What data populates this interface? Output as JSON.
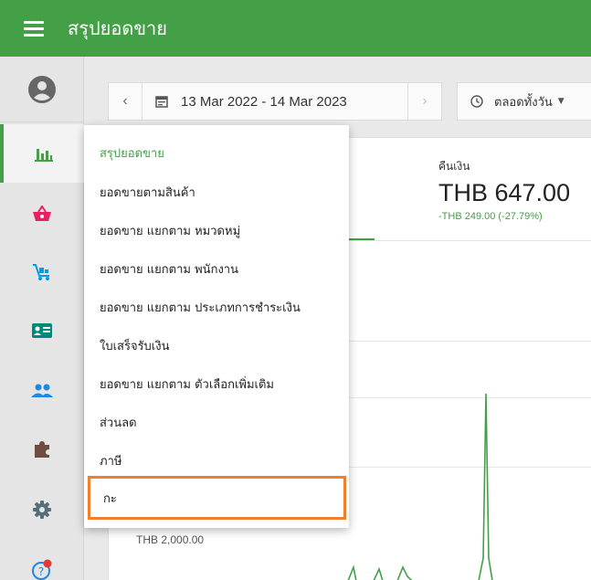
{
  "app": {
    "title": "สรุปยอดขาย"
  },
  "colors": {
    "primary": "#43a047",
    "highlight": "#f08030",
    "badge": "#e53935"
  },
  "sidebar": {
    "items": [
      {
        "name": "profile-icon",
        "active": false
      },
      {
        "name": "bar-chart-icon",
        "active": true
      },
      {
        "name": "basket-icon",
        "active": false
      },
      {
        "name": "cart-icon",
        "active": false
      },
      {
        "name": "id-card-icon",
        "active": false
      },
      {
        "name": "people-icon",
        "active": false
      },
      {
        "name": "puzzle-icon",
        "active": false
      },
      {
        "name": "gear-icon",
        "active": false
      },
      {
        "name": "help-icon",
        "active": false
      }
    ]
  },
  "toolbar": {
    "date_range": "13 Mar 2022 - 14 Mar 2023",
    "time_filter": "ตลอดทั้งวัน"
  },
  "metric": {
    "label": "คืนเงิน",
    "value": "THB 647.00",
    "delta": "-THB 249.00 (-27.79%)"
  },
  "chart": {
    "y_label": "THB 2,000.00"
  },
  "menu": {
    "items": [
      "สรุปยอดขาย",
      "ยอดขายตามสินค้า",
      "ยอดขาย แยกตาม หมวดหมู่",
      "ยอดขาย แยกตาม พนักงาน",
      "ยอดขาย แยกตาม ประเภทการชำระเงิน",
      "ใบเสร็จรับเงิน",
      "ยอดขาย แยกตาม ตัวเลือกเพิ่มเติม",
      "ส่วนลด",
      "ภาษี",
      "กะ"
    ]
  }
}
